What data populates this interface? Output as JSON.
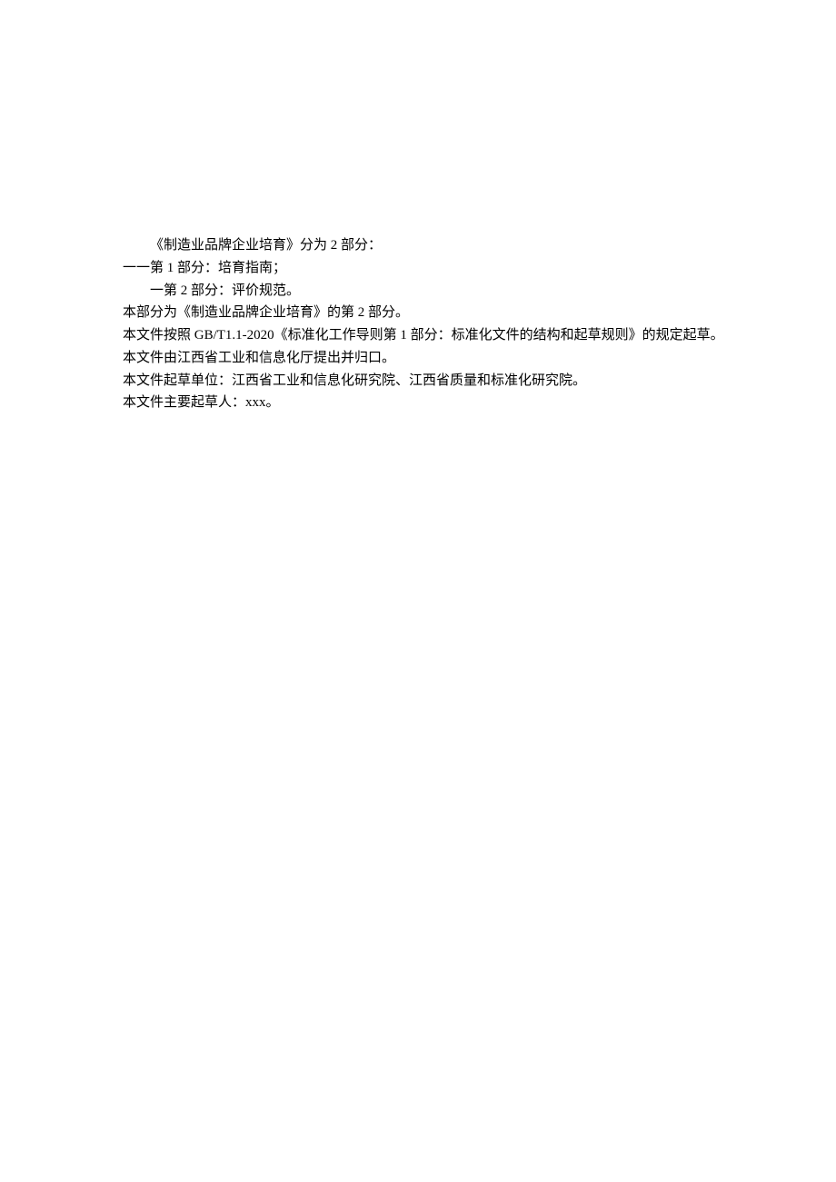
{
  "lines": {
    "l1": "《制造业品牌企业培育》分为 2 部分：",
    "l2": "一一第 1 部分：培育指南；",
    "l3": "一第 2 部分：评价规范。",
    "l4": "本部分为《制造业品牌企业培育》的第 2 部分。",
    "l5": "本文件按照 GB/T1.1-2020《标准化工作导则第 1 部分：标准化文件的结构和起草规则》的规定起草。",
    "l6": "本文件由江西省工业和信息化厅提出并归口。",
    "l7": "本文件起草单位：江西省工业和信息化研究院、江西省质量和标准化研究院。",
    "l8": "本文件主要起草人：xxx。"
  }
}
